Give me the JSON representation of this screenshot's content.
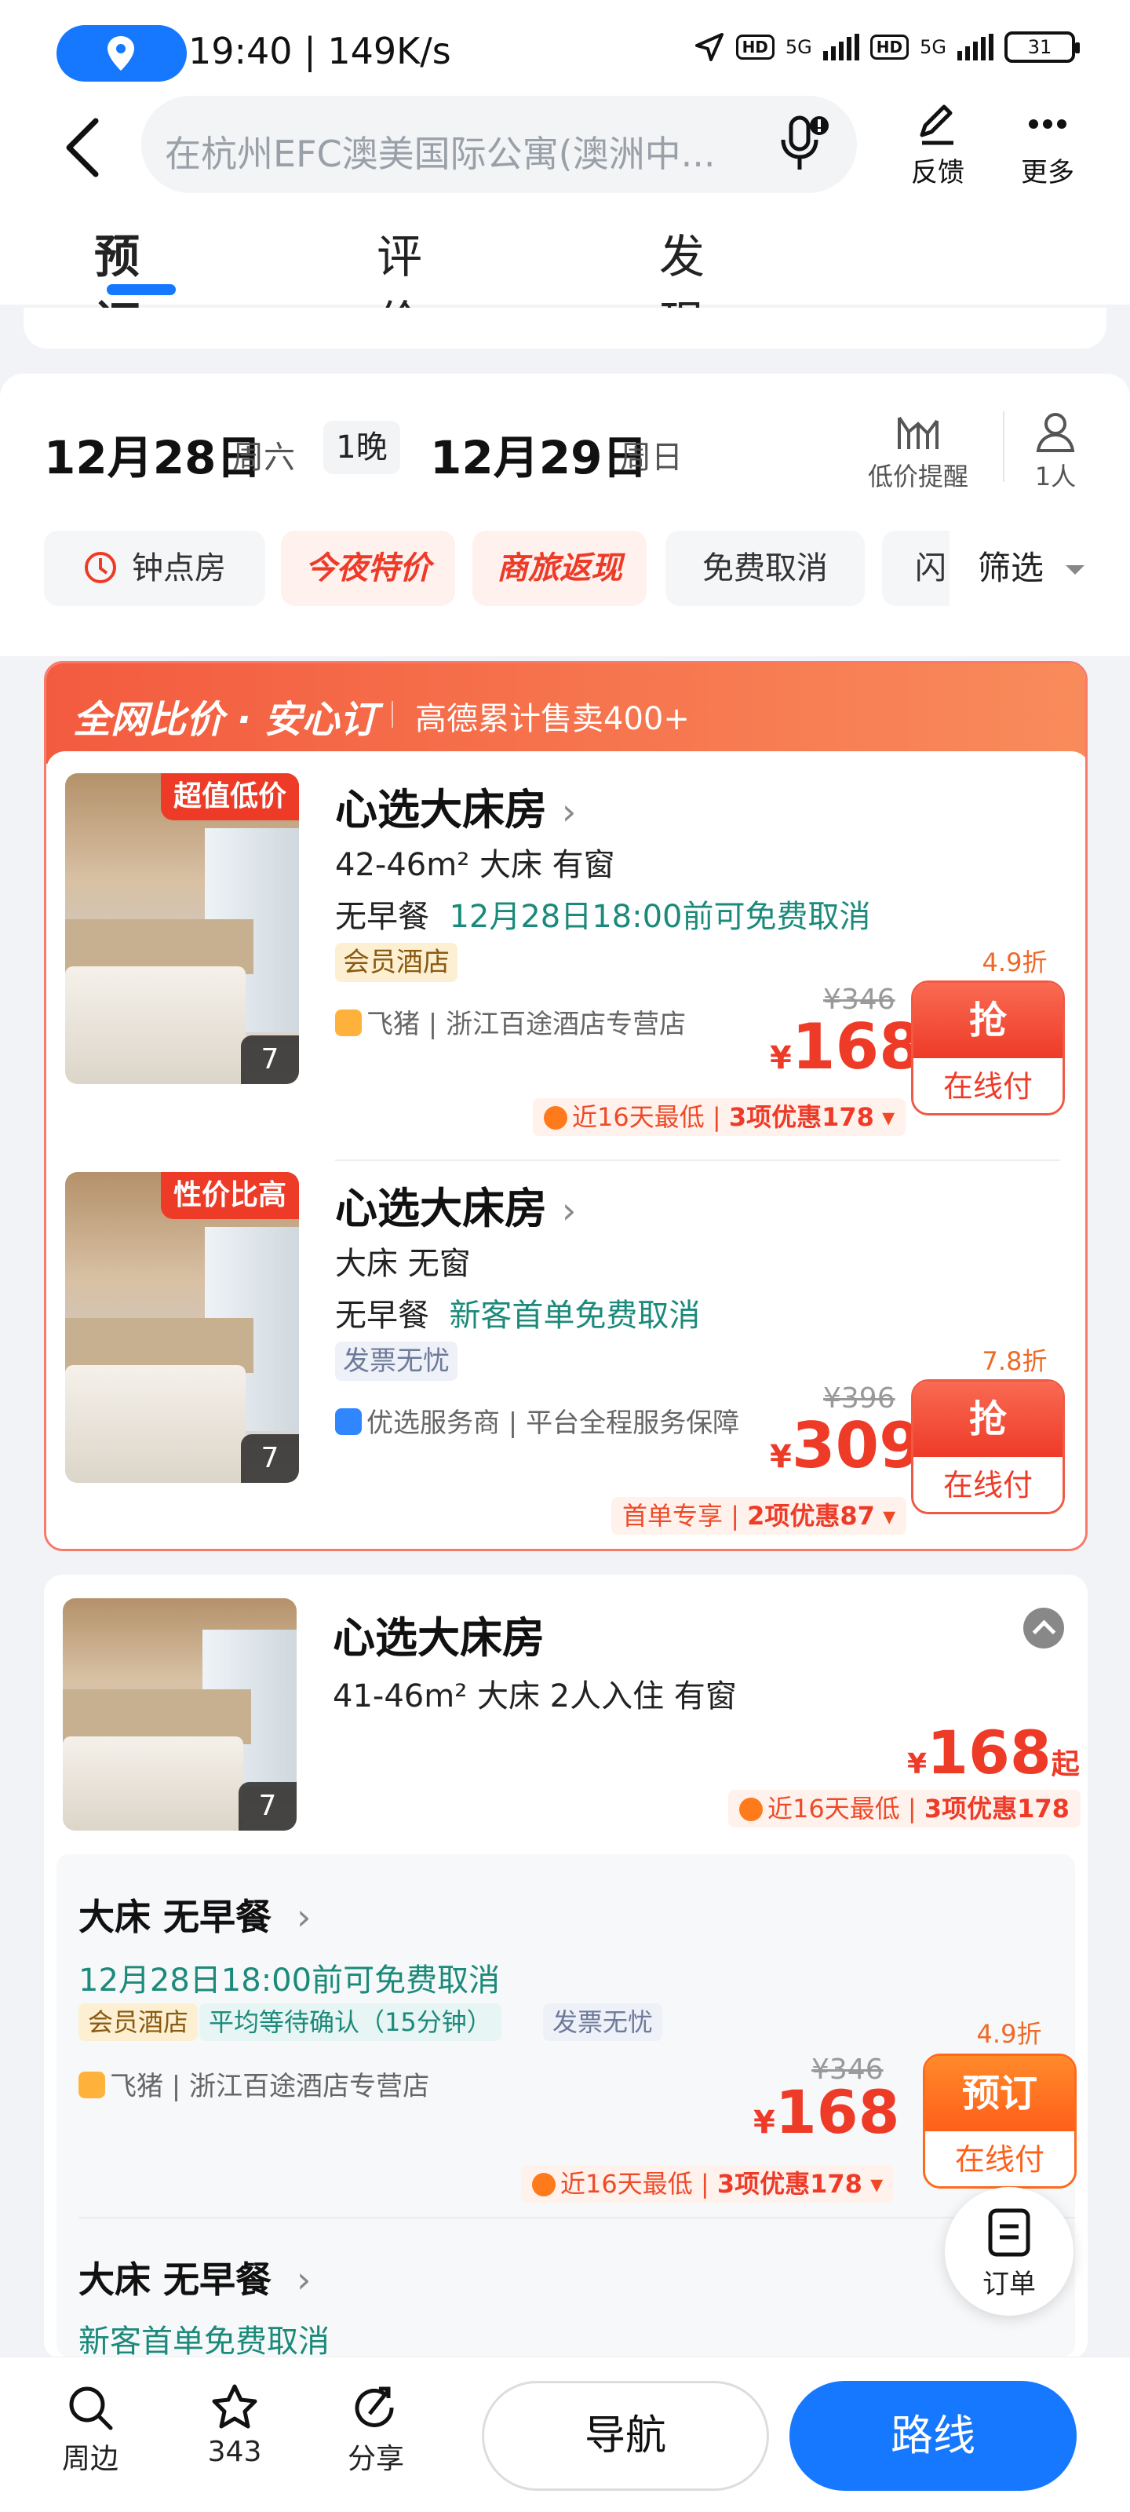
{
  "status_bar": {
    "time": "19:40",
    "speed": "149K/s",
    "hd1": "HD",
    "net1": "5G",
    "hd2": "HD",
    "net2": "5G",
    "battery": "31"
  },
  "header": {
    "search_text": "在杭州EFC澳美国际公寓(澳洲中...",
    "feedback_label": "反馈",
    "more_label": "更多",
    "tabs": [
      {
        "label": "预订"
      },
      {
        "label": "评价"
      },
      {
        "label": "发现"
      }
    ]
  },
  "date_bar": {
    "checkin_date": "12月28日",
    "checkin_weekday": "周六",
    "nights": "1晚",
    "checkout_date": "12月29日",
    "checkout_weekday": "周日",
    "price_alert_label": "低价提醒",
    "guests_label": "1人",
    "chips": [
      "钟点房",
      "今夜特价",
      "商旅返现",
      "免费取消",
      "闪"
    ],
    "filter_label": "筛选"
  },
  "promo_card": {
    "title": "全网比价 · 安心订",
    "subtitle": "高德累计售卖400+",
    "rooms": [
      {
        "tag": "超值低价",
        "photo_count": "7",
        "name": "心选大床房",
        "specs": "42-46m² 大床 有窗",
        "breakfast": "无早餐",
        "cancel": "12月28日18:00前可免费取消",
        "badge": "会员酒店",
        "seller": "飞猪 | 浙江百途酒店专营店",
        "discount": "4.9折",
        "old_price": "¥346",
        "currency": "¥",
        "price": "168",
        "btn_top": "抢",
        "btn_bottom": "在线付",
        "promo_text": "近16天最低",
        "promo_bold": "3项优惠178",
        "promo_arrow": "▾"
      },
      {
        "tag": "性价比高",
        "photo_count": "7",
        "name": "心选大床房",
        "specs": "大床 无窗",
        "breakfast": "无早餐",
        "cancel": "新客首单免费取消",
        "badge": "发票无忧",
        "seller": "优选服务商 | 平台全程服务保障",
        "discount": "7.8折",
        "old_price": "¥396",
        "currency": "¥",
        "price": "309",
        "btn_top": "抢",
        "btn_bottom": "在线付",
        "promo_text": "首单专享",
        "promo_bold": "2项优惠87",
        "promo_arrow": "▾"
      }
    ]
  },
  "room_card": {
    "photo_count": "7",
    "name": "心选大床房",
    "specs": "41-46m² 大床 2人入住 有窗",
    "currency": "¥",
    "price": "168",
    "price_suffix": "起",
    "promo_text": "近16天最低",
    "promo_bold": "3项优惠178",
    "options": [
      {
        "title": "大床 无早餐",
        "cancel": "12月28日18:00前可免费取消",
        "badges": [
          "会员酒店",
          "平均等待确认（15分钟）",
          "发票无忧"
        ],
        "seller": "飞猪 | 浙江百途酒店专营店",
        "discount": "4.9折",
        "old_price": "¥346",
        "currency": "¥",
        "price": "168",
        "btn_top": "预订",
        "btn_bottom": "在线付",
        "promo_text": "近16天最低",
        "promo_bold": "3项优惠178",
        "promo_arrow": "▾"
      },
      {
        "title": "大床 无早餐",
        "cancel": "新客首单免费取消"
      }
    ]
  },
  "order_fab": {
    "label": "订单"
  },
  "bottom_bar": {
    "nearby_label": "周边",
    "favorite_count": "343",
    "share_label": "分享",
    "navigate_label": "导航",
    "route_label": "路线"
  },
  "colors": {
    "accent_blue": "#1677ff",
    "price_red": "#ee3b28",
    "cancel_green": "#1b8a7a"
  }
}
